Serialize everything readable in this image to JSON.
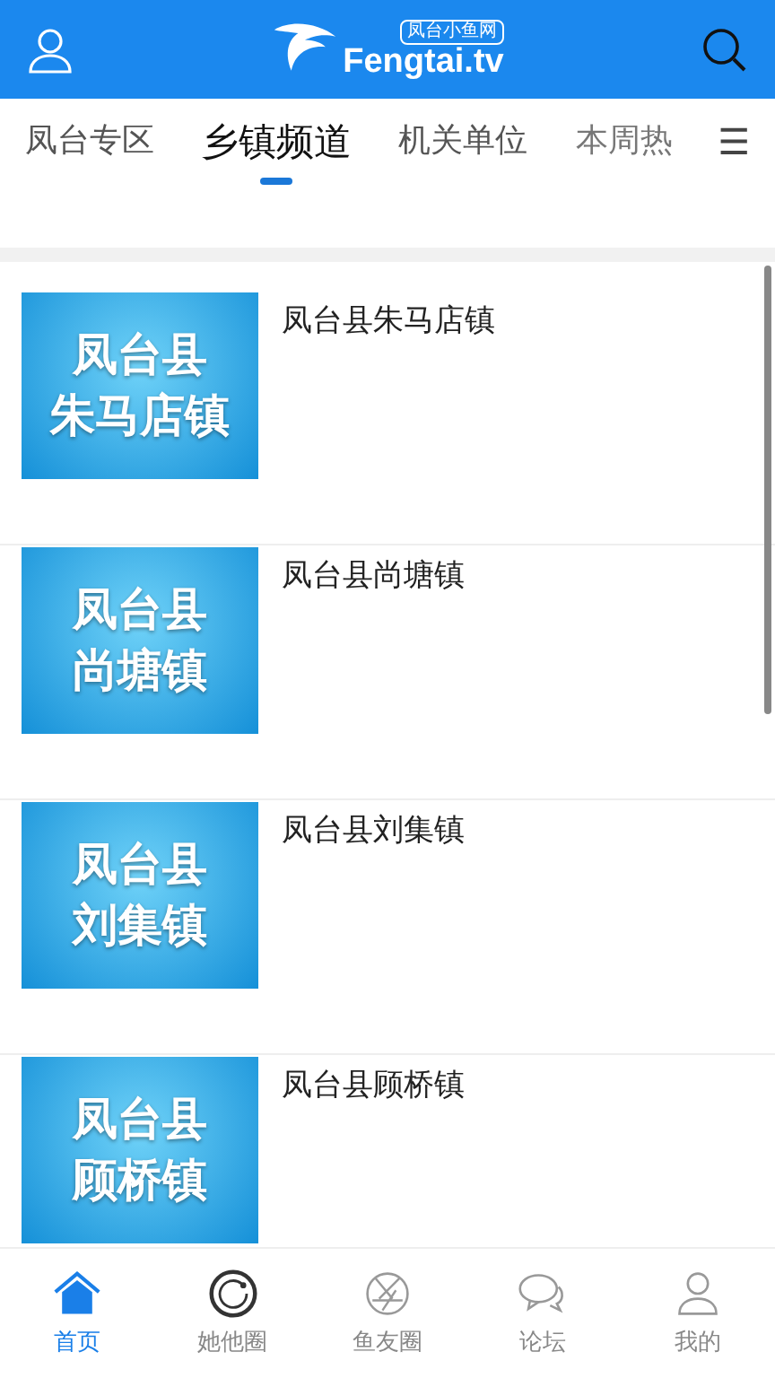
{
  "header": {
    "logo_badge": "凤台小鱼网",
    "logo_text": "Fengtai.tv"
  },
  "tabs": [
    {
      "label": "凤台专区",
      "selected": false
    },
    {
      "label": "乡镇频道",
      "selected": true
    },
    {
      "label": "机关单位",
      "selected": false
    },
    {
      "label": "本周热",
      "selected": false
    }
  ],
  "menu_glyph": "☰",
  "items": [
    {
      "title": "凤台县朱马店镇",
      "thumb_lines": [
        "凤台县",
        "朱马店镇"
      ]
    },
    {
      "title": "凤台县尚塘镇",
      "thumb_lines": [
        "凤台县",
        "尚塘镇"
      ]
    },
    {
      "title": "凤台县刘集镇",
      "thumb_lines": [
        "凤台县",
        "刘集镇"
      ]
    },
    {
      "title": "凤台县顾桥镇",
      "thumb_lines": [
        "凤台县",
        "顾桥镇"
      ]
    }
  ],
  "nav": [
    {
      "label": "首页",
      "kind": "home",
      "selected": true
    },
    {
      "label": "她他圈",
      "kind": "ring",
      "selected": false
    },
    {
      "label": "鱼友圈",
      "kind": "aperture",
      "selected": false
    },
    {
      "label": "论坛",
      "kind": "chat",
      "selected": false
    },
    {
      "label": "我的",
      "kind": "person",
      "selected": false
    }
  ]
}
